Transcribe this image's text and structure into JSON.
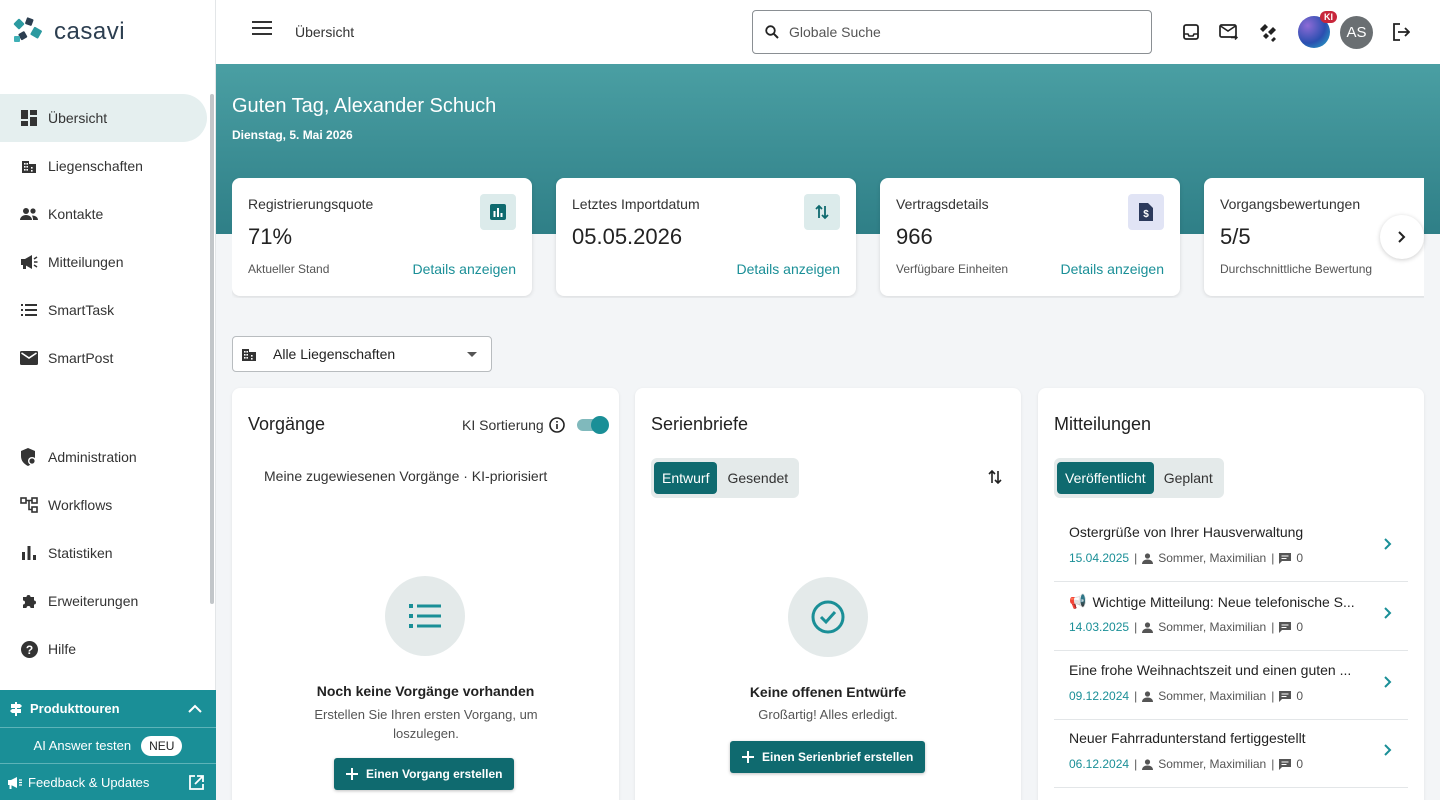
{
  "app": {
    "logo_text": "casavi"
  },
  "sidebar": {
    "items": [
      {
        "label": "Übersicht",
        "icon": "dashboard-icon"
      },
      {
        "label": "Liegenschaften",
        "icon": "building-icon"
      },
      {
        "label": "Kontakte",
        "icon": "people-icon"
      },
      {
        "label": "Mitteilungen",
        "icon": "megaphone-icon"
      },
      {
        "label": "SmartTask",
        "icon": "list-icon"
      },
      {
        "label": "SmartPost",
        "icon": "mail-icon"
      }
    ],
    "items2": [
      {
        "label": "Administration",
        "icon": "admin-icon"
      },
      {
        "label": "Workflows",
        "icon": "workflow-icon"
      },
      {
        "label": "Statistiken",
        "icon": "bar-chart-icon"
      },
      {
        "label": "Erweiterungen",
        "icon": "puzzle-icon"
      },
      {
        "label": "Hilfe",
        "icon": "help-icon"
      }
    ],
    "promo": {
      "tours": "Produkttouren",
      "ai_answer": "AI Answer testen",
      "ai_badge": "NEU",
      "feedback": "Feedback & Updates"
    }
  },
  "topbar": {
    "breadcrumb": "Übersicht",
    "search_placeholder": "Globale Suche",
    "ki_badge": "KI",
    "avatar_initials": "AS"
  },
  "hero": {
    "greeting": "Guten Tag, Alexander Schuch",
    "date": "Dienstag, 5. Mai 2026"
  },
  "stats": [
    {
      "title": "Registrierungsquote",
      "value": "71%",
      "sub": "Aktueller Stand",
      "link": "Details anzeigen",
      "icon": "chart-icon"
    },
    {
      "title": "Letztes Importdatum",
      "value": "05.05.2026",
      "sub": "",
      "link": "Details anzeigen",
      "icon": "swap-vertical-icon"
    },
    {
      "title": "Vertragsdetails",
      "value": "966",
      "sub": "Verfügbare Einheiten",
      "link": "Details anzeigen",
      "icon": "dollar-document-icon"
    },
    {
      "title": "Vorgangsbewertungen",
      "value": "5/5",
      "sub": "Durchschnittliche Bewertung",
      "link": "",
      "icon": ""
    }
  ],
  "filter": {
    "selected": "Alle Liegenschaften"
  },
  "vorgaenge": {
    "title": "Vorgänge",
    "ki_label": "KI Sortierung",
    "subtitle": "Meine zugewiesenen Vorgänge · KI-priorisiert",
    "empty_title": "Noch keine Vorgänge vorhanden",
    "empty_sub": "Erstellen Sie Ihren ersten Vorgang, um loszulegen.",
    "button": "Einen Vorgang erstellen"
  },
  "serienbriefe": {
    "title": "Serienbriefe",
    "tabs": [
      "Entwurf",
      "Gesendet"
    ],
    "empty_title": "Keine offenen Entwürfe",
    "empty_sub": "Großartig! Alles erledigt.",
    "button": "Einen Serienbrief erstellen"
  },
  "mitteilungen": {
    "title": "Mitteilungen",
    "tabs": [
      "Veröffentlicht",
      "Geplant"
    ],
    "items": [
      {
        "title": "Ostergrüße von Ihrer Hausverwaltung",
        "date": "15.04.2025",
        "author": "Sommer, Maximilian",
        "comments": "0",
        "flag": ""
      },
      {
        "title": "Wichtige Mitteilung: Neue telefonische S...",
        "date": "14.03.2025",
        "author": "Sommer, Maximilian",
        "comments": "0",
        "flag": "📢"
      },
      {
        "title": "Eine frohe Weihnachtszeit und einen guten ...",
        "date": "09.12.2024",
        "author": "Sommer, Maximilian",
        "comments": "0",
        "flag": ""
      },
      {
        "title": "Neuer Fahrradunterstand fertiggestellt",
        "date": "06.12.2024",
        "author": "Sommer, Maximilian",
        "comments": "0",
        "flag": ""
      }
    ]
  },
  "colors": {
    "accent": "#1a8f97",
    "primary_dark": "#0f6a6f",
    "hero_top": "#4a9fa3",
    "hero_bottom": "#2f7f87"
  }
}
